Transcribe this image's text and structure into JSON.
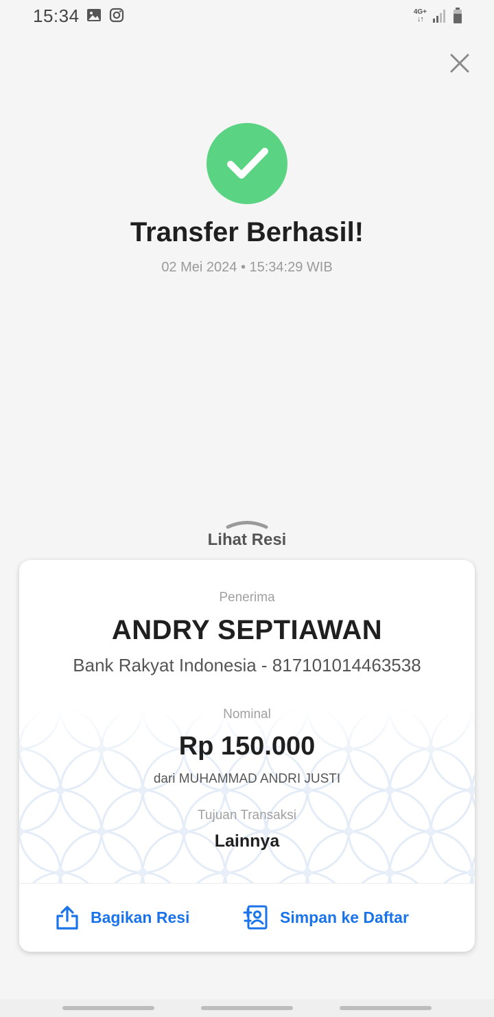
{
  "status_bar": {
    "time": "15:34",
    "network": "4G+",
    "icons": [
      "gallery-icon",
      "instagram-icon",
      "signal-icon",
      "battery-icon"
    ]
  },
  "header": {
    "close_icon": "close-icon"
  },
  "success": {
    "icon": "check-icon",
    "title": "Transfer Berhasil!",
    "datetime": "02 Mei 2024 • 15:34:29 WIB"
  },
  "receipt_toggle": {
    "label": "Lihat Resi",
    "icon": "chevron-up-icon"
  },
  "receipt": {
    "recipient_label": "Penerima",
    "recipient_name": "ANDRY SEPTIAWAN",
    "recipient_bank": "Bank Rakyat Indonesia - 817101014463538",
    "amount_label": "Nominal",
    "amount": "Rp 150.000",
    "sender": "dari MUHAMMAD ANDRI JUSTI",
    "purpose_label": "Tujuan Transaksi",
    "purpose": "Lainnya"
  },
  "actions": {
    "share_label": "Bagikan Resi",
    "share_icon": "share-icon",
    "save_label": "Simpan ke Daftar",
    "save_icon": "contact-add-icon"
  },
  "colors": {
    "success_green": "#5ad382",
    "action_blue": "#1a73e8",
    "background": "#f5f5f5"
  }
}
